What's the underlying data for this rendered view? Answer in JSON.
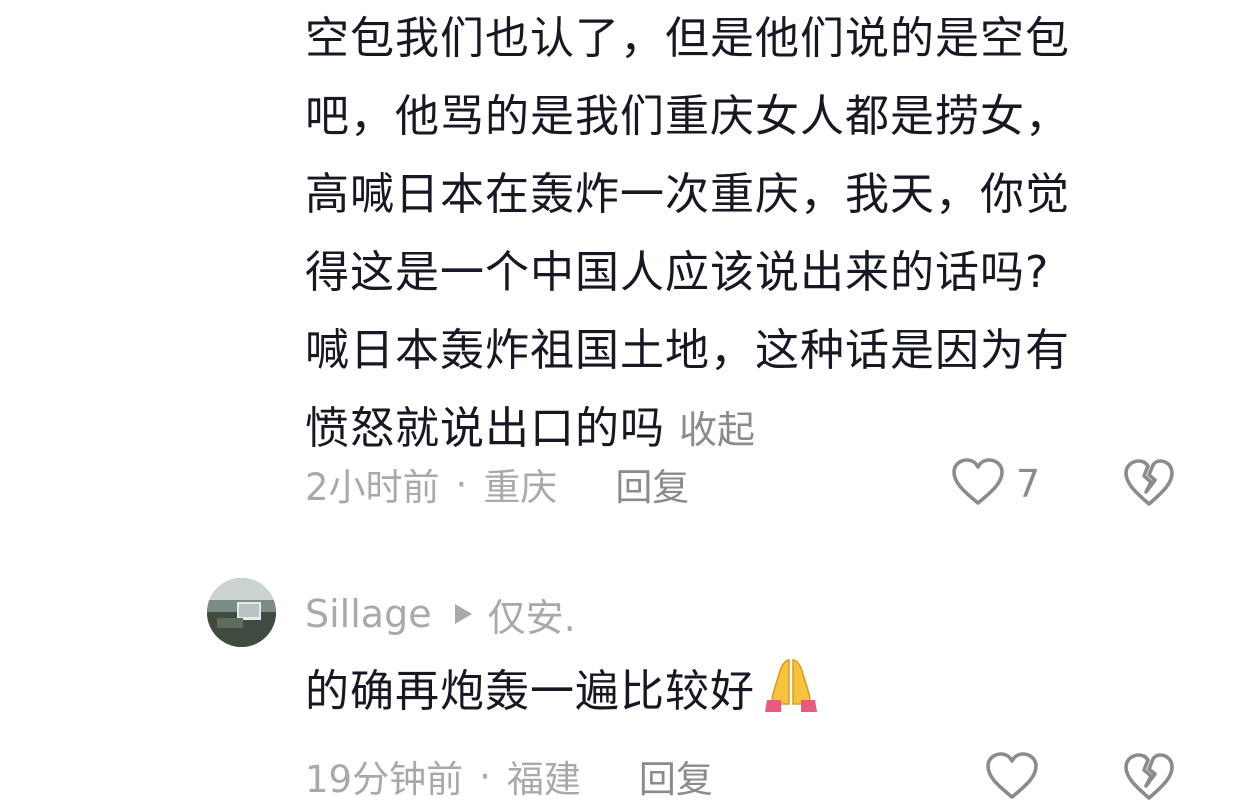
{
  "comments": [
    {
      "lines": [
        "空包我们也认了，但是他们说的是空包",
        "吧，他骂的是我们重庆女人都是捞女，",
        "高喊日本在轰炸一次重庆，我天，你觉",
        "得这是一个中国人应该说出来的话吗?",
        "喊日本轰炸祖国土地，这种话是因为有",
        "愤怒就说出口的吗"
      ],
      "collapse_label": "收起",
      "time": "2小时前",
      "separator": "·",
      "location": "重庆",
      "reply_label": "回复",
      "like_count": "7",
      "icons": [
        "heart-outline-icon",
        "broken-heart-icon"
      ]
    },
    {
      "username": "Sillage",
      "reply_to": "仅安.",
      "text": "的确再炮轰一遍比较好",
      "emoji": "folded-hands-icon",
      "time": "19分钟前",
      "separator": "·",
      "location": "福建",
      "reply_label": "回复",
      "icons": [
        "avatar",
        "reply-arrow-icon",
        "heart-outline-icon",
        "broken-heart-icon"
      ]
    }
  ],
  "colors": {
    "text_primary": "#161823",
    "text_secondary": "#8a8b91",
    "text_tertiary": "#a8a9ad",
    "emoji_yellow": "#f7c23c",
    "emoji_sleeve": "#e85b7c",
    "background": "#ffffff"
  }
}
